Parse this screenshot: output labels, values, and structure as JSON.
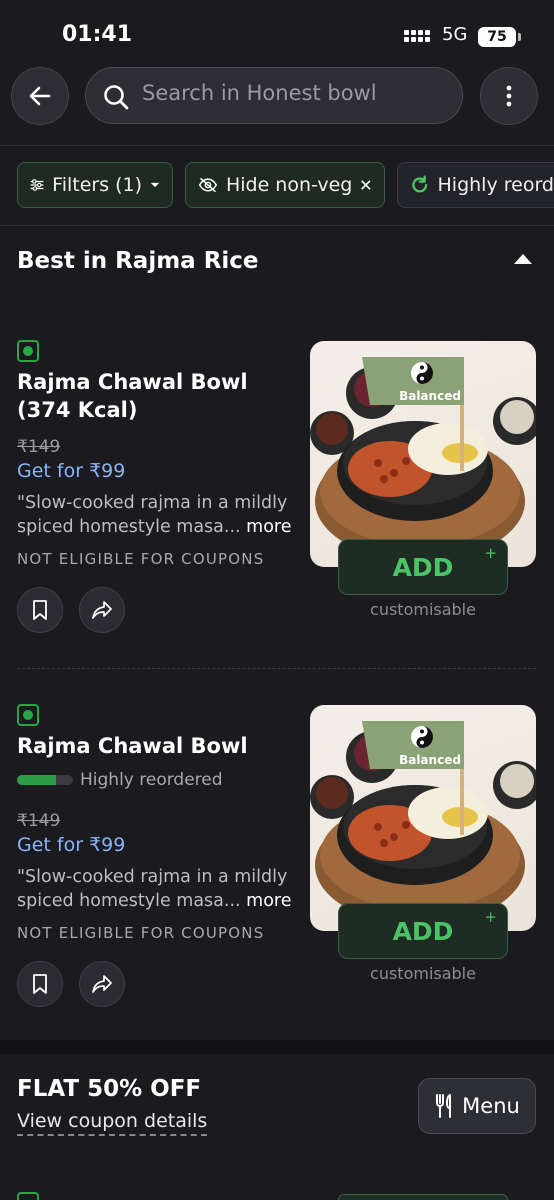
{
  "status_bar": {
    "time": "01:41",
    "network": "5G",
    "battery": "75"
  },
  "header": {
    "search_placeholder": "Search in Honest bowl"
  },
  "filters": [
    {
      "label": "Filters (1)",
      "icon": "sliders-icon",
      "trailing": "chevron-down-icon"
    },
    {
      "label": "Hide non-veg",
      "icon": "eye-off-icon",
      "trailing": "close-icon"
    },
    {
      "label": "Highly reord",
      "icon": "refresh-icon"
    }
  ],
  "section": {
    "title": "Best in Rajma Rice"
  },
  "items": [
    {
      "name": "Rajma Chawal Bowl\n(374 Kcal)",
      "price_old": "₹149",
      "price_new": "Get for ₹99",
      "desc": "\"Slow-cooked rajma in a mildly spiced homestyle masa...",
      "more": "more",
      "coupon_note": "NOT ELIGIBLE FOR COUPONS",
      "image_tag": "Balanced",
      "add_label": "ADD",
      "add_plus": "+",
      "customisable": "customisable"
    },
    {
      "name": "Rajma Chawal Bowl",
      "reorder_label": "Highly reordered",
      "reorder_level": 0.7,
      "price_old": "₹149",
      "price_new": "Get for ₹99",
      "desc": "\"Slow-cooked rajma in a mildly spiced homestyle masa...",
      "more": "more",
      "coupon_note": "NOT ELIGIBLE FOR COUPONS",
      "image_tag": "Balanced",
      "add_label": "ADD",
      "add_plus": "+",
      "customisable": "customisable"
    }
  ],
  "offer": {
    "title": "FLAT 50% OFF",
    "link": "View coupon details"
  },
  "menu_button": {
    "label": "Menu",
    "icon": "fork-knife-icon"
  },
  "colors": {
    "background": "#1a1a1f",
    "accent_green": "#4cc366",
    "veg_green": "#27a845",
    "price_blue": "#8ab4f8"
  }
}
